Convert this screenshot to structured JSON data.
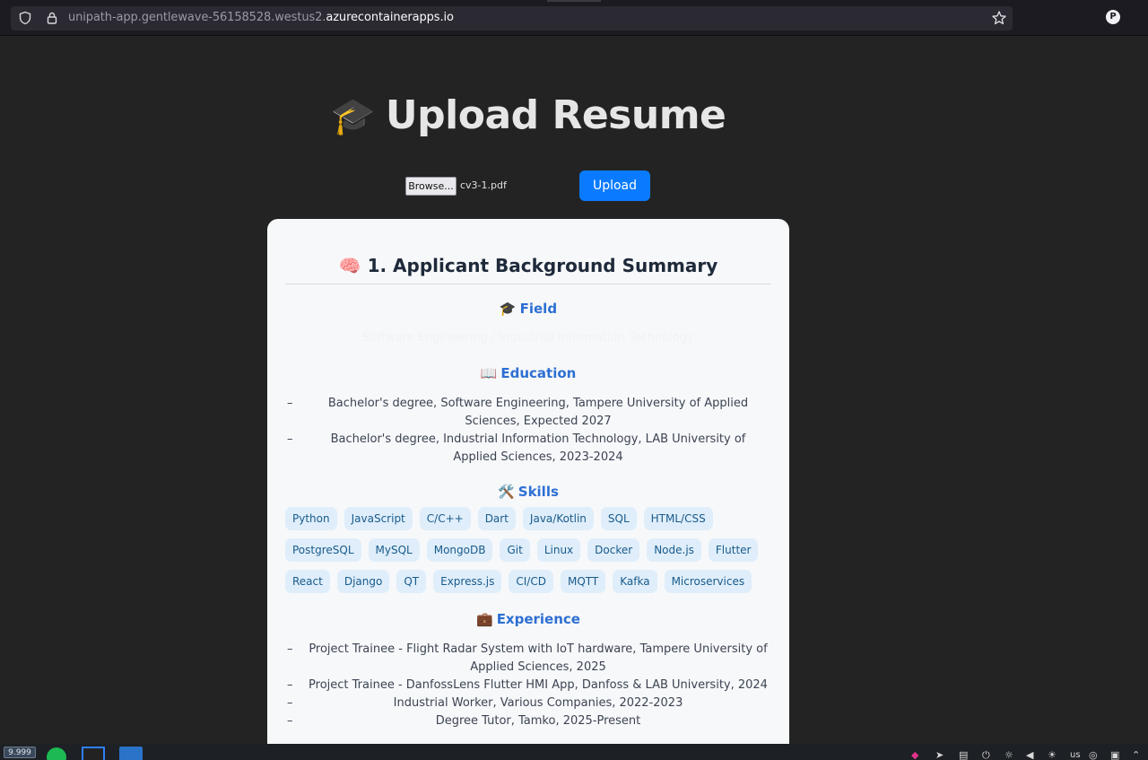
{
  "browser": {
    "url_prefix": "unipath-app.gentlewave-56158528.westus2.",
    "url_domain": "azurecontainerapps.io",
    "profile_initial": "P",
    "icons": [
      "shield-icon",
      "lock-icon",
      "bookmark-star-icon",
      "profile-icon"
    ]
  },
  "header": {
    "emoji": "🎓",
    "title": "Upload Resume"
  },
  "upload": {
    "browse_label": "Browse...",
    "file_name": "cv3-1.pdf",
    "upload_label": "Upload",
    "accent_color": "#0a7bff"
  },
  "summary": {
    "emoji": "🧠",
    "title": "1. Applicant Background Summary",
    "field": {
      "emoji": "🎓",
      "heading": "Field",
      "value": "Software Engineering / Industrial Information Technology"
    },
    "education": {
      "emoji": "📖",
      "heading": "Education",
      "items": [
        "Bachelor's degree, Software Engineering, Tampere University of Applied Sciences, Expected 2027",
        "Bachelor's degree, Industrial Information Technology, LAB University of Applied Sciences, 2023-2024"
      ]
    },
    "skills": {
      "emoji": "🛠️",
      "heading": "Skills",
      "items": [
        "Python",
        "JavaScript",
        "C/C++",
        "Dart",
        "Java/Kotlin",
        "SQL",
        "HTML/CSS",
        "PostgreSQL",
        "MySQL",
        "MongoDB",
        "Git",
        "Linux",
        "Docker",
        "Node.js",
        "Flutter",
        "React",
        "Django",
        "QT",
        "Express.js",
        "CI/CD",
        "MQTT",
        "Kafka",
        "Microservices"
      ]
    },
    "experience": {
      "emoji": "💼",
      "heading": "Experience",
      "items": [
        "Project Trainee - Flight Radar System with IoT hardware, Tampere University of Applied Sciences, 2025",
        "Project Trainee - DanfossLens Flutter HMI App, Danfoss & LAB University, 2024",
        "Industrial Worker, Various Companies, 2022-2023",
        "Degree Tutor, Tamko, 2025-Present"
      ]
    },
    "bullet": "–"
  },
  "taskbar": {
    "counter": "9.999",
    "tray_lang": "us"
  },
  "colors": {
    "page_background": "#232323",
    "card_background": "#f7f8fa",
    "section_heading": "#2d6fd3",
    "chip_background": "#dfeefa",
    "chip_text": "#1a5b8c"
  }
}
